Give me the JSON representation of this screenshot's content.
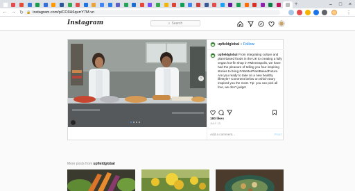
{
  "browser": {
    "url": "instagram.com/p/CC6H6qurrY7M-vn",
    "tab_colors": [
      "#ffffff",
      "#e24c4c",
      "#e04e3a",
      "#3a7bd5",
      "#1b9e4b",
      "#2f6fde",
      "#ff9900",
      "#2b579a",
      "#34a853",
      "#e24c4c",
      "#1a73e8",
      "#e8a33c",
      "#4285f4",
      "#2b7de9",
      "#5b5fc7",
      "#22a559",
      "#1c6dd0",
      "#e8453c",
      "#7c4dff",
      "#34a853",
      "#f4b400",
      "#db4437",
      "#0f9d58",
      "#4285f4",
      "#cf3c3c",
      "#3b5998",
      "#e24c4c",
      "#1da1f2",
      "#6a1b9a",
      "#1b9e4b",
      "#ff6d00",
      "#d93025",
      "#8e24aa",
      "#0b8043",
      "#c2185b",
      "#bdbdbd"
    ],
    "new_tab_label": "+",
    "minimize": "–",
    "maximize": "□",
    "close": "×"
  },
  "header": {
    "logo": "Instagram",
    "search_placeholder": "Search"
  },
  "post": {
    "username": "upfieldglobal",
    "separator": "•",
    "follow_label": "Follow",
    "caption_user": "upfieldglobal",
    "caption": "From integrating culture and plant-based foods in the UK to creating a fully vegan hot-fin shop in #Minneapolis, we have had the pleasure of telling you four inspiring stories to bring #ABetterPlantBasedFuture. Are you ready to take on a new healthy lifestyle? Comment below on which story inspired you the most. Tip: you can pick all four, we don't judge!",
    "likes": "180 likes",
    "date": "JULY 13",
    "comment_placeholder": "Add a comment...",
    "post_label": "Post"
  },
  "more": {
    "prefix": "More posts from",
    "username": "upfieldglobal"
  },
  "colors": {
    "link": "#3897f0",
    "brand_green": "#1f7a2c",
    "border": "#dbdbdb"
  }
}
